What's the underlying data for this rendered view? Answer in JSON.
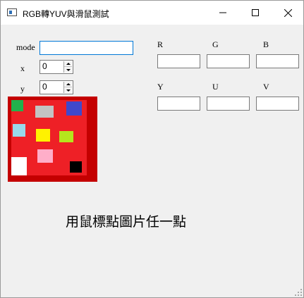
{
  "window": {
    "title": "RGB轉YUV與滑鼠測試",
    "icon": "app-window-icon",
    "controls": [
      "minimize-icon",
      "maximize-icon",
      "close-icon"
    ]
  },
  "inputs": {
    "mode_label": "mode",
    "mode_value": "",
    "x_label": "x",
    "x_value": "0",
    "y_label": "y",
    "y_value": "0"
  },
  "rgb": {
    "r_label": "R",
    "g_label": "G",
    "b_label": "B",
    "r_value": "",
    "g_value": "",
    "b_value": ""
  },
  "yuv": {
    "y_label": "Y",
    "u_label": "U",
    "v_label": "V",
    "y_value": "",
    "u_value": "",
    "v_value": ""
  },
  "picture": {
    "frame_color": "#c40000",
    "background_color": "#ee2026",
    "swatches": [
      "#22b24c",
      "#c3c3c3",
      "#3f48cc",
      "#99d9ea",
      "#fff200",
      "#b5e61d",
      "#ffaec9",
      "#ffffff",
      "#000000"
    ]
  },
  "caption": "用鼠標點圖片任一點"
}
